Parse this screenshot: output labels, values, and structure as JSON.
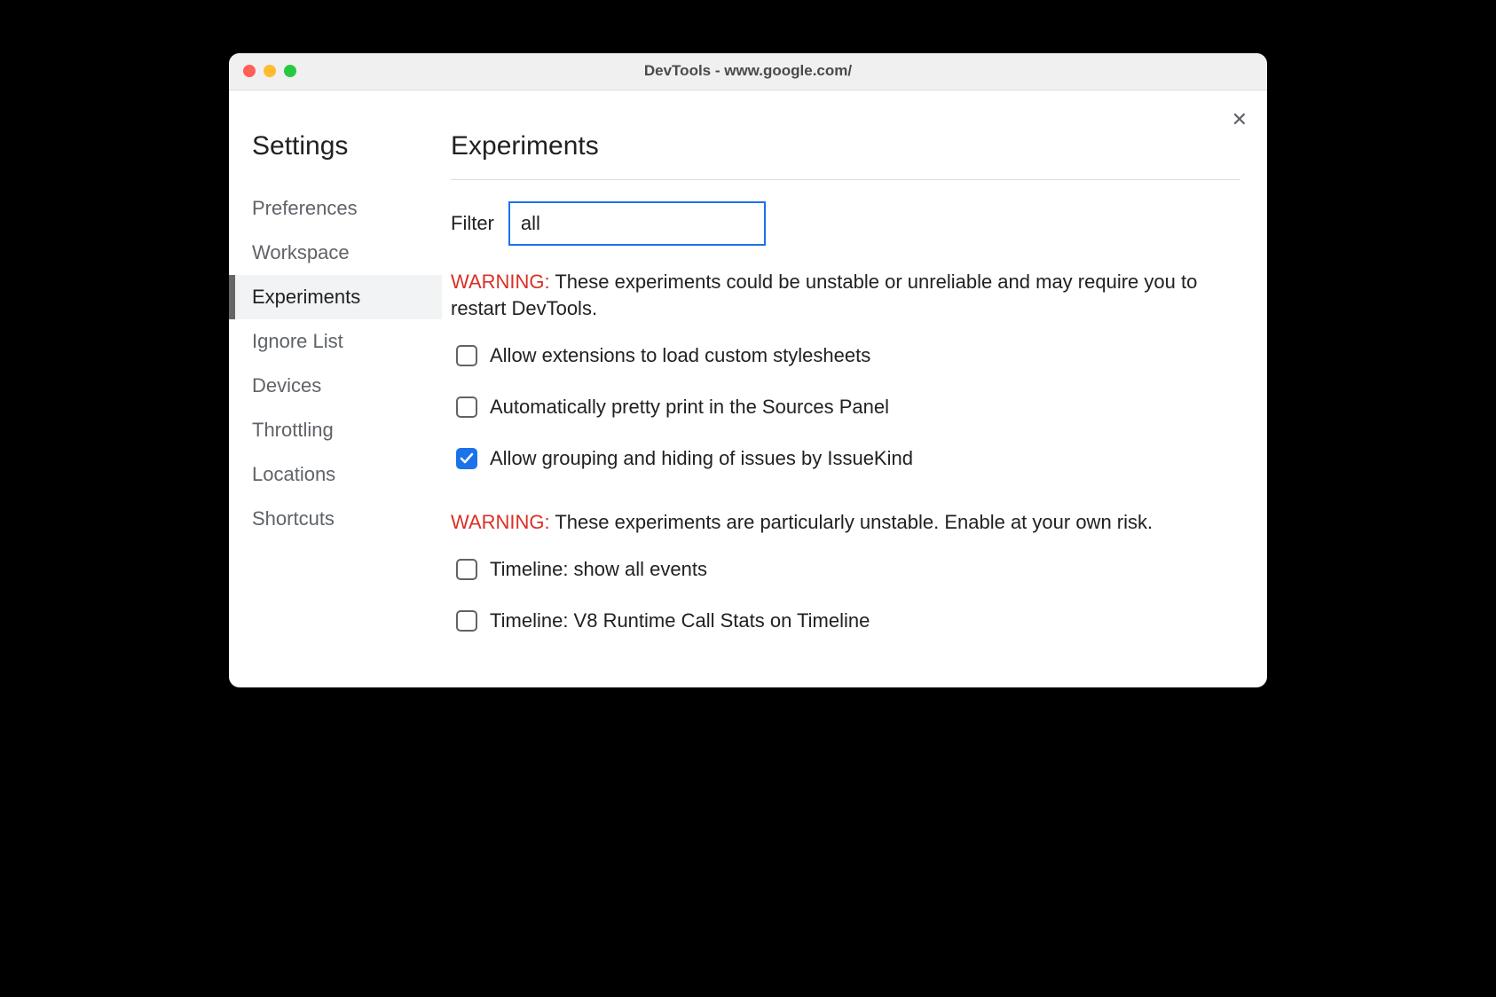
{
  "window": {
    "title": "DevTools - www.google.com/"
  },
  "sidebar": {
    "title": "Settings",
    "items": [
      {
        "label": "Preferences",
        "active": false
      },
      {
        "label": "Workspace",
        "active": false
      },
      {
        "label": "Experiments",
        "active": true
      },
      {
        "label": "Ignore List",
        "active": false
      },
      {
        "label": "Devices",
        "active": false
      },
      {
        "label": "Throttling",
        "active": false
      },
      {
        "label": "Locations",
        "active": false
      },
      {
        "label": "Shortcuts",
        "active": false
      }
    ]
  },
  "main": {
    "title": "Experiments",
    "filter_label": "Filter",
    "filter_value": "all",
    "warning1_prefix": "WARNING:",
    "warning1_text": " These experiments could be unstable or unreliable and may require you to restart DevTools.",
    "warning2_prefix": "WARNING:",
    "warning2_text": " These experiments are particularly unstable. Enable at your own risk.",
    "experiments_group1": [
      {
        "label": "Allow extensions to load custom stylesheets",
        "checked": false
      },
      {
        "label": "Automatically pretty print in the Sources Panel",
        "checked": false
      },
      {
        "label": "Allow grouping and hiding of issues by IssueKind",
        "checked": true
      }
    ],
    "experiments_group2": [
      {
        "label": "Timeline: show all events",
        "checked": false
      },
      {
        "label": "Timeline: V8 Runtime Call Stats on Timeline",
        "checked": false
      }
    ]
  }
}
